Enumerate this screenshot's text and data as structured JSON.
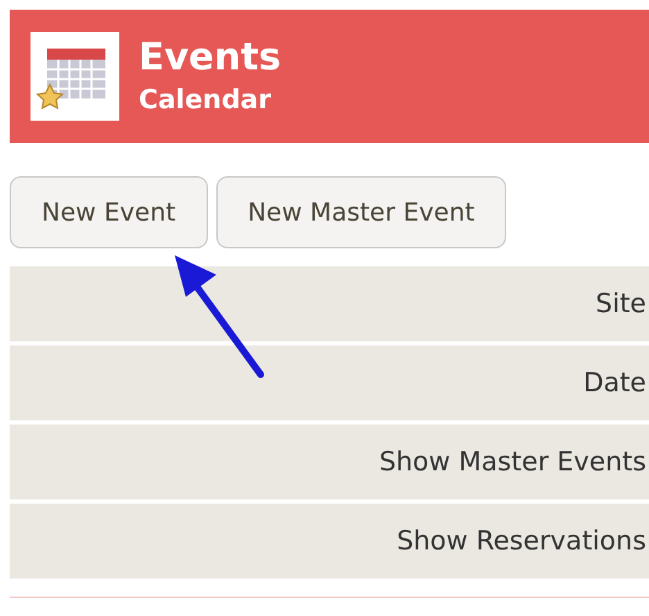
{
  "header": {
    "title": "Events",
    "subtitle": "Calendar"
  },
  "buttons": [
    "New Event",
    "New Master Event"
  ],
  "filters": [
    {
      "label": "Site"
    },
    {
      "label": "Date"
    },
    {
      "label": "Show Master Events"
    },
    {
      "label": "Show Reservations"
    }
  ]
}
